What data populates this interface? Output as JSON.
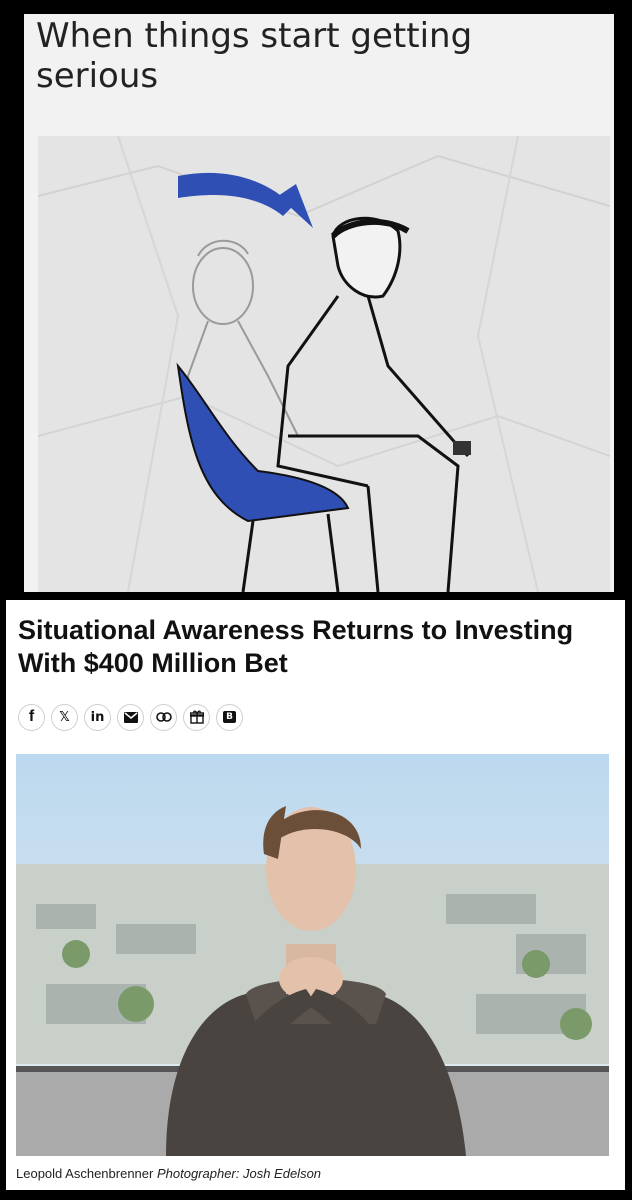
{
  "meme": {
    "caption": "When things start getting serious",
    "colors": {
      "chair": "#2f4fb5",
      "arrow": "#2f4fb5",
      "paper": "#e6e6e6"
    }
  },
  "article": {
    "headline": "Situational Awareness Returns to Investing With $400 Million Bet",
    "share_icons": [
      "facebook-icon",
      "x-icon",
      "linkedin-icon",
      "email-icon",
      "link-icon",
      "gift-icon",
      "bloomberg-icon"
    ],
    "share_labels": {
      "linkedin": "in",
      "x": "𝕏",
      "facebook": "f",
      "bloomberg": "B"
    },
    "photo_caption": {
      "subject": "Leopold Aschenbrenner",
      "credit": "Photographer: Josh Edelson"
    }
  }
}
